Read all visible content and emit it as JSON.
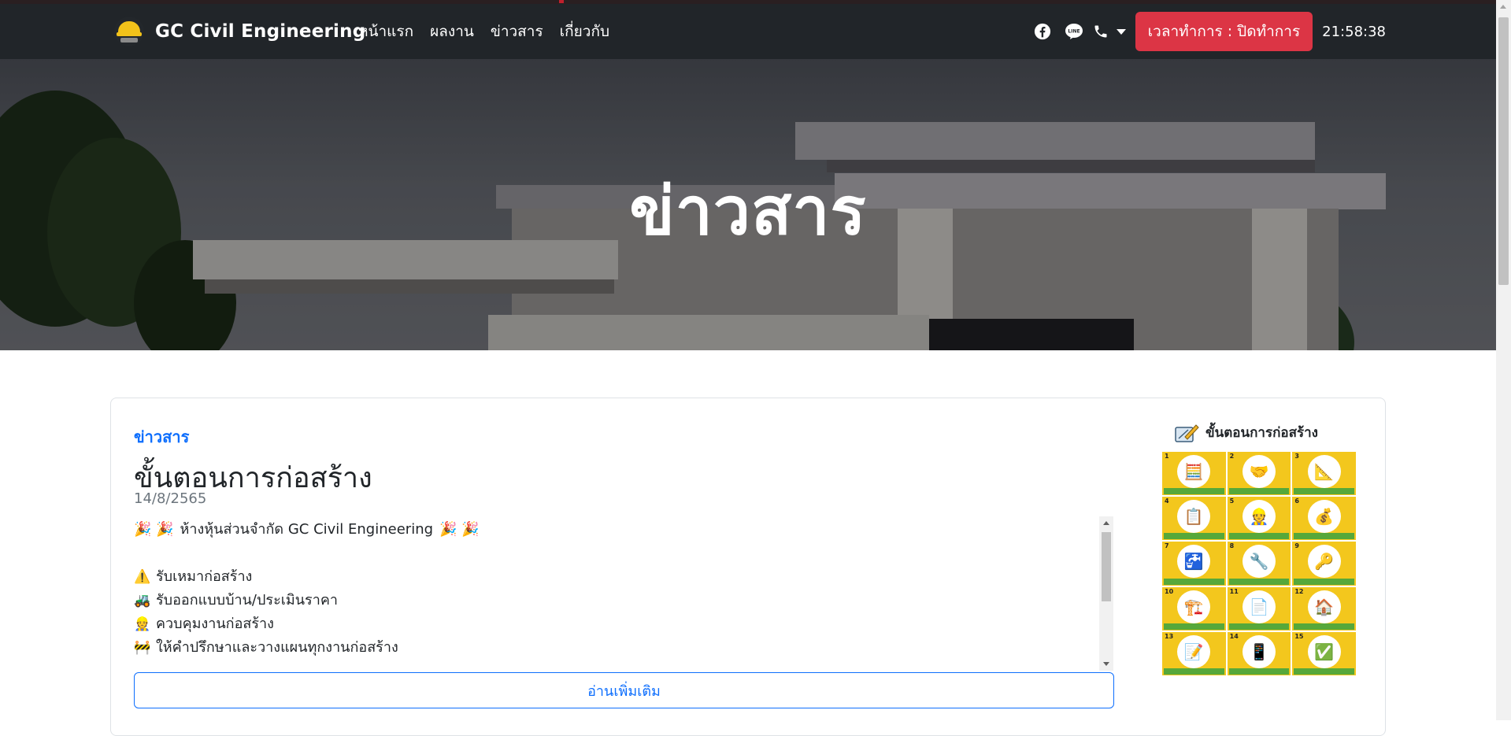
{
  "navbar": {
    "brand_name": "GC Civil Engineering",
    "links": [
      "หน้าแรก",
      "ผลงาน",
      "ข่าวสาร",
      "เกี่ยวกับ"
    ],
    "hours_label": "เวลาทำการ : ปิดทำการ",
    "clock": "21:58:38",
    "icons": [
      "facebook-icon",
      "line-icon",
      "phone-icon",
      "chevron-down-icon"
    ]
  },
  "hero": {
    "title": "ข่าวสาร"
  },
  "post": {
    "category": "ข่าวสาร",
    "title": "ขั้นตอนการก่อสร้าง",
    "date": "14/8/2565",
    "lines": [
      {
        "emoji": "🎉 🎉",
        "text": "ห้างหุ้นส่วนจำกัด GC Civil Engineering",
        "emoji_after": "🎉 🎉"
      },
      {
        "emoji": "",
        "text": "",
        "emoji_after": ""
      },
      {
        "emoji": "⚠️",
        "text": "รับเหมาก่อสร้าง",
        "emoji_after": ""
      },
      {
        "emoji": "🚜",
        "text": "รับออกแบบบ้าน/ประเมินราคา",
        "emoji_after": ""
      },
      {
        "emoji": "👷",
        "text": "ควบคุมงานก่อสร้าง",
        "emoji_after": ""
      },
      {
        "emoji": "🚧",
        "text": "ให้คำปรึกษาและวางแผนทุกงานก่อสร้าง",
        "emoji_after": ""
      }
    ],
    "read_more": "อ่านเพิ่มเติม"
  },
  "sidebar": {
    "heading": "ขั้นตอนการก่อสร้าง",
    "steps": [
      {
        "n": "1",
        "icon": "🧮"
      },
      {
        "n": "2",
        "icon": "🤝"
      },
      {
        "n": "3",
        "icon": "📐"
      },
      {
        "n": "4",
        "icon": "📋"
      },
      {
        "n": "5",
        "icon": "👷"
      },
      {
        "n": "6",
        "icon": "💰"
      },
      {
        "n": "7",
        "icon": "🚰"
      },
      {
        "n": "8",
        "icon": "🔧"
      },
      {
        "n": "9",
        "icon": "🔑"
      },
      {
        "n": "10",
        "icon": "🏗️"
      },
      {
        "n": "11",
        "icon": "📄"
      },
      {
        "n": "12",
        "icon": "🏠"
      },
      {
        "n": "13",
        "icon": "📝"
      },
      {
        "n": "14",
        "icon": "📱"
      },
      {
        "n": "15",
        "icon": "✅"
      }
    ]
  },
  "colors": {
    "navbar_bg": "#212529",
    "accent_red": "#dc3545",
    "link_blue": "#0d6efd",
    "tile_yellow": "#f3c71d"
  }
}
